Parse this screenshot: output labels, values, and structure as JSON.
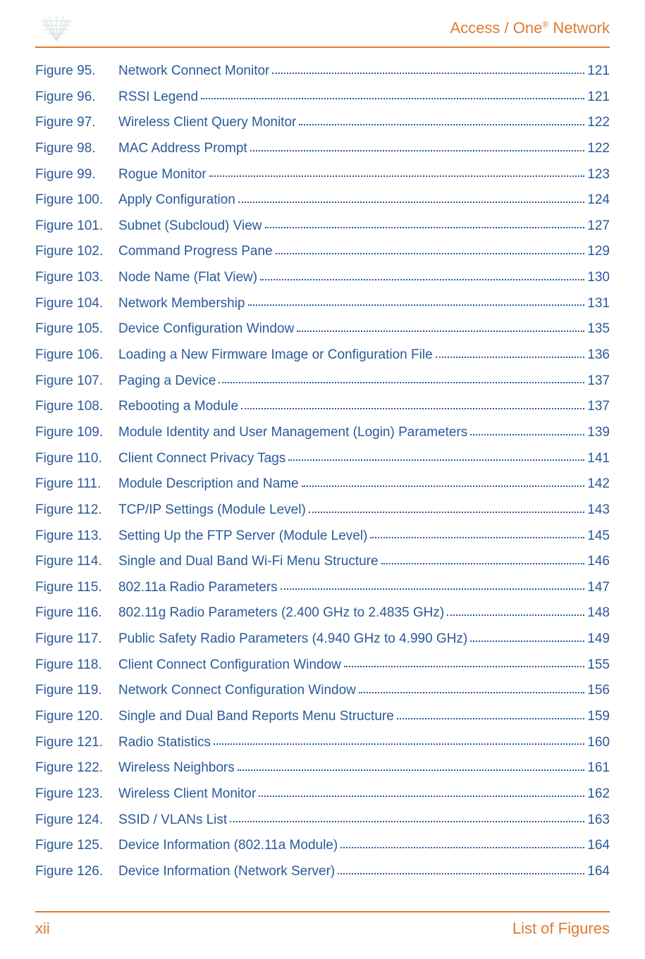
{
  "header": {
    "title_prefix": "Access / One",
    "title_suffix": " Network",
    "reg": "®"
  },
  "entries": [
    {
      "fig": "Figure 95.",
      "desc": "Network Connect Monitor",
      "page": "121"
    },
    {
      "fig": "Figure 96.",
      "desc": "RSSI Legend",
      "page": "121"
    },
    {
      "fig": "Figure 97.",
      "desc": "Wireless Client Query Monitor",
      "page": "122"
    },
    {
      "fig": "Figure 98.",
      "desc": "MAC Address Prompt",
      "page": "122"
    },
    {
      "fig": "Figure 99.",
      "desc": "Rogue Monitor",
      "page": "123"
    },
    {
      "fig": "Figure 100.",
      "desc": "Apply Configuration",
      "page": "124"
    },
    {
      "fig": "Figure 101.",
      "desc": "Subnet (Subcloud) View",
      "page": "127"
    },
    {
      "fig": "Figure 102.",
      "desc": "Command Progress Pane",
      "page": "129"
    },
    {
      "fig": "Figure 103.",
      "desc": "Node Name (Flat View)",
      "page": "130"
    },
    {
      "fig": "Figure 104.",
      "desc": "Network Membership",
      "page": "131"
    },
    {
      "fig": "Figure 105.",
      "desc": "Device Configuration Window",
      "page": "135"
    },
    {
      "fig": "Figure 106.",
      "desc": "Loading a New Firmware Image or Configuration File",
      "page": "136"
    },
    {
      "fig": "Figure 107.",
      "desc": "Paging a Device",
      "page": "137"
    },
    {
      "fig": "Figure 108.",
      "desc": "Rebooting a Module",
      "page": "137"
    },
    {
      "fig": "Figure 109.",
      "desc": "Module Identity and User Management (Login) Parameters",
      "page": "139"
    },
    {
      "fig": "Figure 110.",
      "desc": "Client Connect Privacy Tags",
      "page": "141"
    },
    {
      "fig": "Figure 111.",
      "desc": "Module Description and Name",
      "page": "142"
    },
    {
      "fig": "Figure 112.",
      "desc": "TCP/IP Settings (Module Level)",
      "page": "143"
    },
    {
      "fig": "Figure 113.",
      "desc": "Setting Up the FTP Server (Module Level)",
      "page": "145"
    },
    {
      "fig": "Figure 114.",
      "desc": "Single and Dual Band Wi-Fi Menu Structure",
      "page": "146"
    },
    {
      "fig": "Figure 115.",
      "desc": "802.11a Radio Parameters",
      "page": "147"
    },
    {
      "fig": "Figure 116.",
      "desc": "802.11g Radio Parameters (2.400 GHz to 2.4835 GHz)",
      "page": "148"
    },
    {
      "fig": "Figure 117.",
      "desc": "Public Safety Radio Parameters (4.940 GHz to 4.990 GHz)",
      "page": "149"
    },
    {
      "fig": "Figure 118.",
      "desc": "Client Connect Configuration Window",
      "page": "155"
    },
    {
      "fig": "Figure 119.",
      "desc": "Network Connect Configuration Window",
      "page": "156"
    },
    {
      "fig": "Figure 120.",
      "desc": "Single and Dual Band Reports Menu Structure",
      "page": "159"
    },
    {
      "fig": "Figure 121.",
      "desc": "Radio Statistics",
      "page": "160"
    },
    {
      "fig": "Figure 122.",
      "desc": "Wireless Neighbors",
      "page": "161"
    },
    {
      "fig": "Figure 123.",
      "desc": "Wireless Client Monitor",
      "page": "162"
    },
    {
      "fig": "Figure 124.",
      "desc": "SSID / VLANs List",
      "page": "163"
    },
    {
      "fig": "Figure 125.",
      "desc": "Device Information (802.11a Module)",
      "page": "164"
    },
    {
      "fig": "Figure 126.",
      "desc": "Device Information (Network Server)",
      "page": "164"
    }
  ],
  "footer": {
    "page": "xii",
    "section": "List of Figures"
  }
}
